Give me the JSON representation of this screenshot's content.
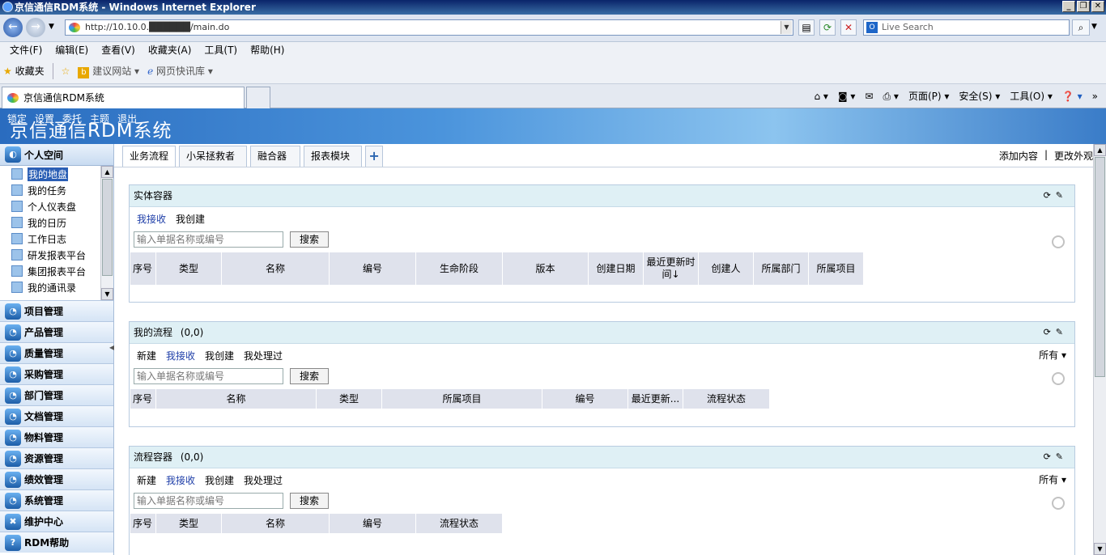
{
  "window": {
    "title": "京信通信RDM系统 - Windows Internet Explorer"
  },
  "browser": {
    "address": "http://10.10.0.██████/main.do",
    "search_placeholder": "Live Search",
    "menu": [
      "文件(F)",
      "编辑(E)",
      "查看(V)",
      "收藏夹(A)",
      "工具(T)",
      "帮助(H)"
    ],
    "favorites": {
      "label": "收藏夹",
      "suggest": "建议网站",
      "slices": "网页快讯库"
    },
    "tab_title": "京信通信RDM系统",
    "commands": {
      "page": "页面(P)",
      "safety": "安全(S)",
      "tools": "工具(O)"
    }
  },
  "banner": {
    "logo": "京信通信RDM系统",
    "links": [
      "锁定",
      "设置",
      "委托",
      "主题",
      "退出"
    ]
  },
  "sidebar": {
    "section": "个人空间",
    "items": [
      "我的地盘",
      "我的任务",
      "个人仪表盘",
      "我的日历",
      "工作日志",
      "研发报表平台",
      "集团报表平台",
      "我的通讯录"
    ],
    "categories": [
      "项目管理",
      "产品管理",
      "质量管理",
      "采购管理",
      "部门管理",
      "文档管理",
      "物料管理",
      "资源管理",
      "绩效管理",
      "系统管理",
      "维护中心",
      "RDM帮助"
    ]
  },
  "main": {
    "tabs": [
      "业务流程",
      "小呆拯救者",
      "融合器",
      "报表模块"
    ],
    "add_content": "添加内容",
    "change_look": "更改外观",
    "search_placeholder": "输入单据名称或编号",
    "search_button": "搜索",
    "all_filter": "所有",
    "portlet1": {
      "title": "实体容器",
      "links": [
        "我接收",
        "我创建"
      ],
      "columns": [
        "序号",
        "类型",
        "名称",
        "编号",
        "生命阶段",
        "版本",
        "创建日期",
        "最近更新时间↓",
        "创建人",
        "所属部门",
        "所属项目"
      ]
    },
    "portlet2": {
      "title": "我的流程",
      "count": "(0,0)",
      "links": [
        "新建",
        "我接收",
        "我创建",
        "我处理过"
      ],
      "columns": [
        "序号",
        "名称",
        "类型",
        "所属项目",
        "编号",
        "最近更新...",
        "流程状态"
      ]
    },
    "portlet3": {
      "title": "流程容器",
      "count": "(0,0)",
      "links": [
        "新建",
        "我接收",
        "我创建",
        "我处理过"
      ],
      "columns": [
        "序号",
        "类型",
        "名称",
        "编号",
        "流程状态"
      ]
    }
  }
}
